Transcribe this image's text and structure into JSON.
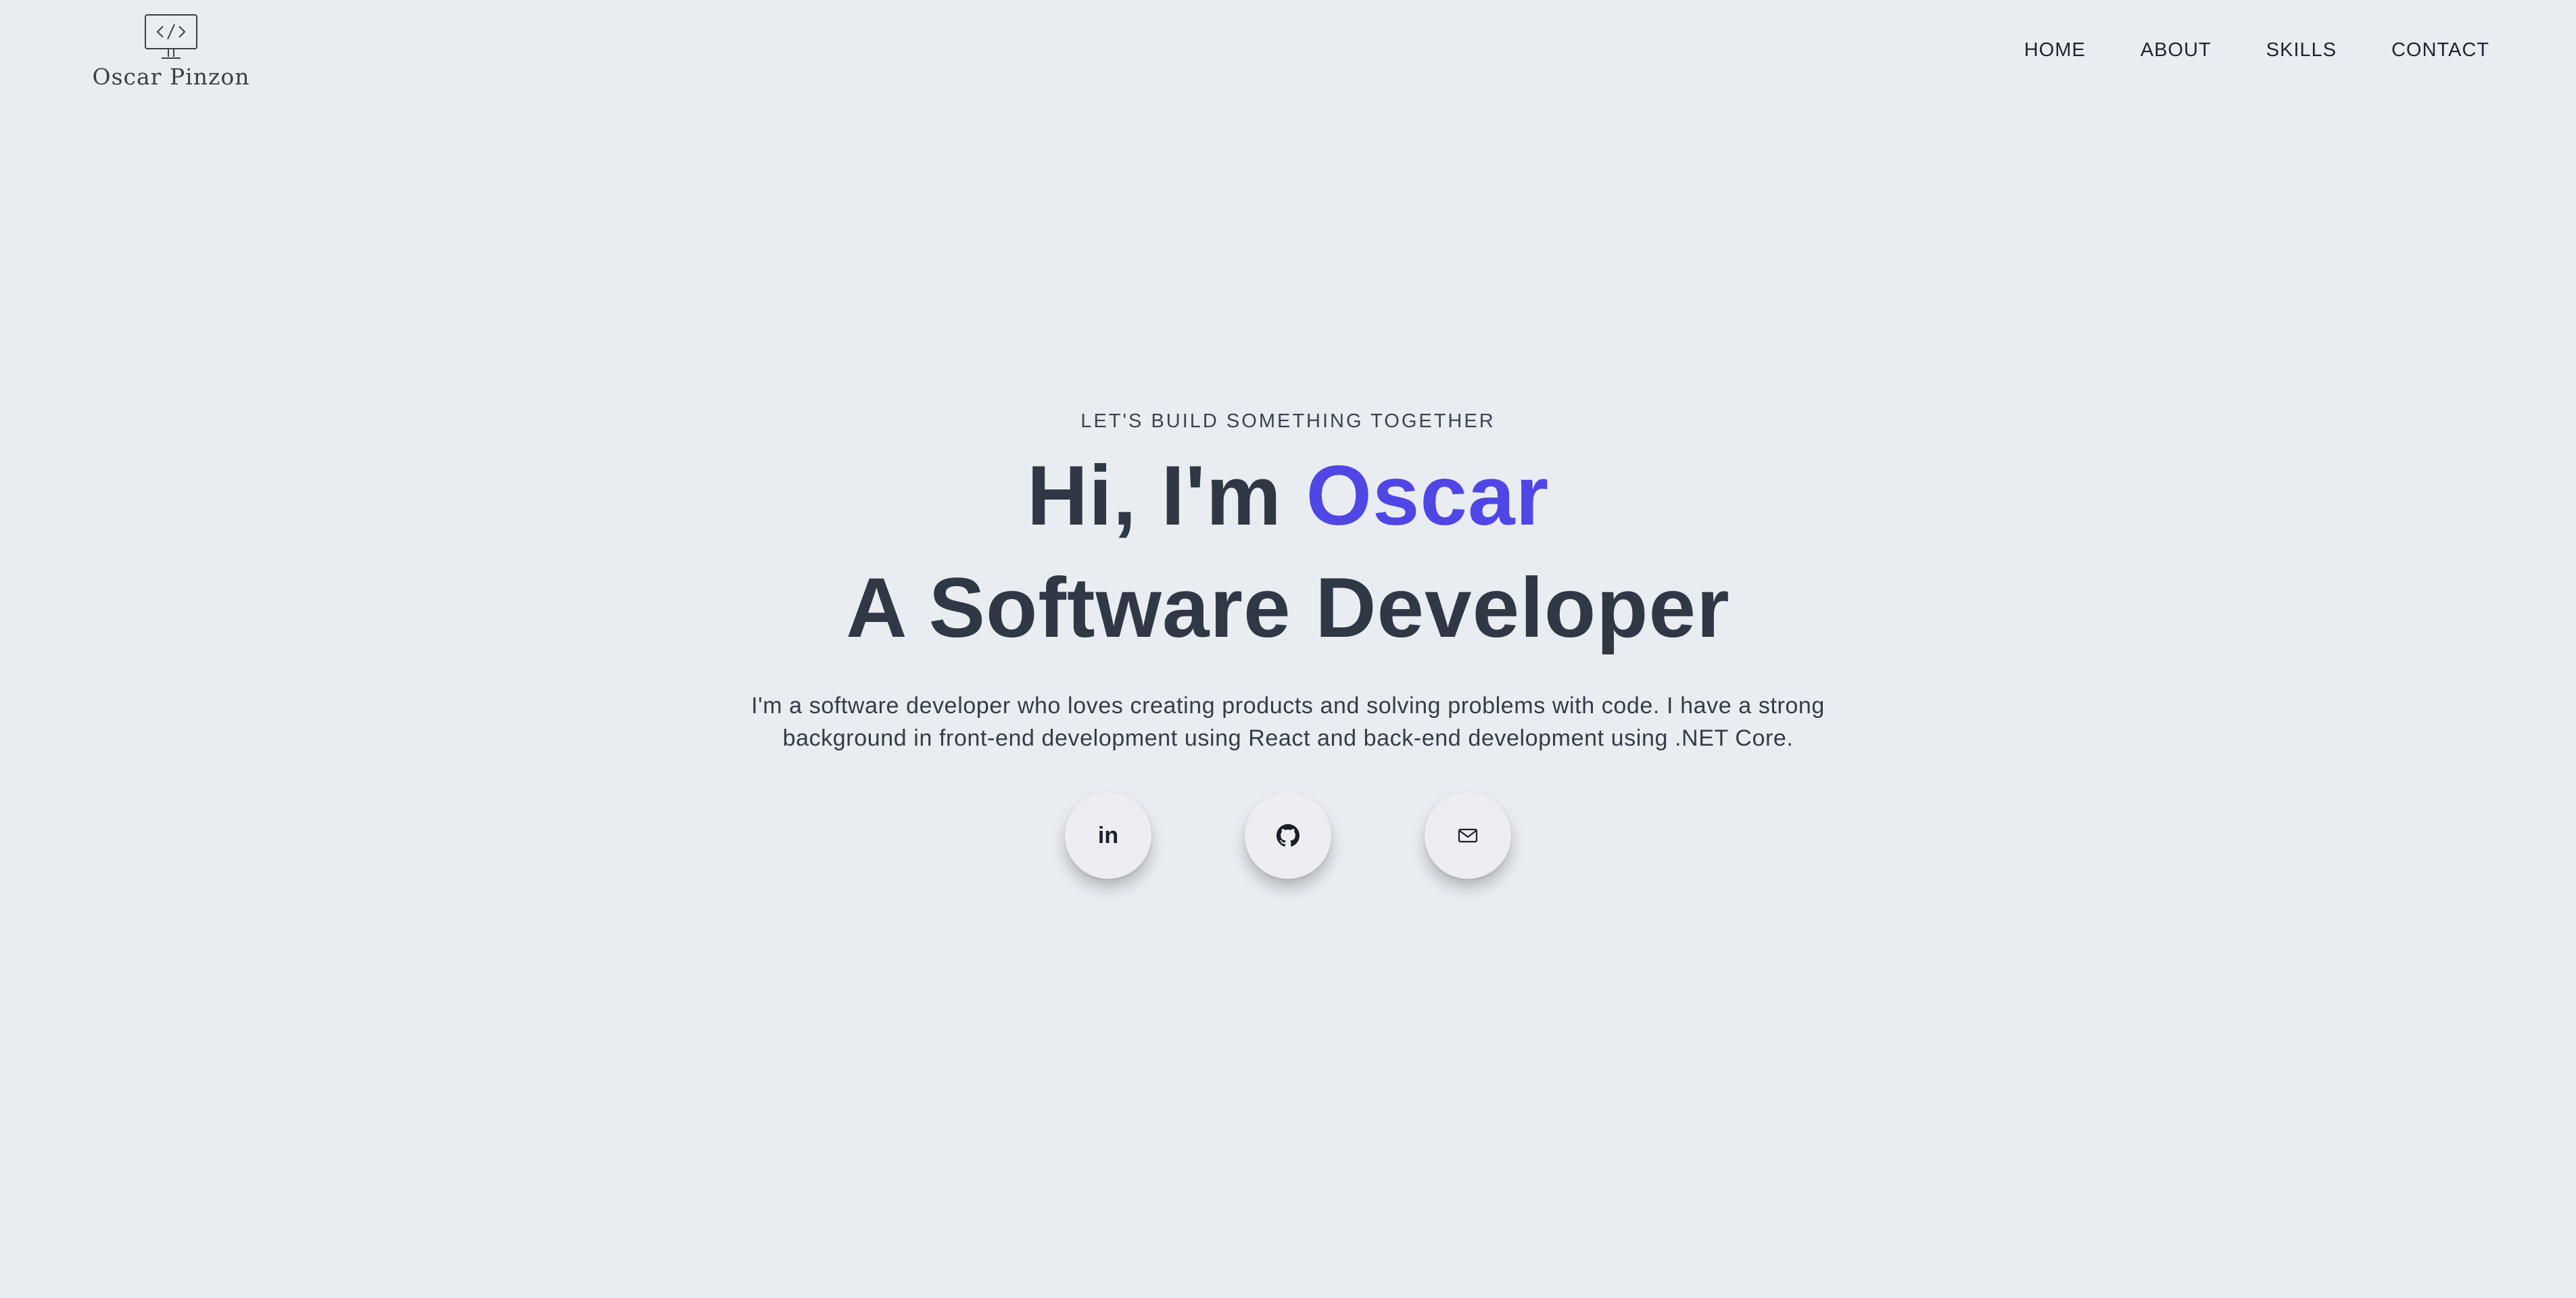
{
  "header": {
    "logo_icon": "code-monitor-icon",
    "logo_name": "Oscar Pinzon",
    "nav": [
      {
        "label": "HOME"
      },
      {
        "label": "ABOUT"
      },
      {
        "label": "SKILLS"
      },
      {
        "label": "CONTACT"
      }
    ]
  },
  "hero": {
    "tagline": "LET'S BUILD SOMETHING TOGETHER",
    "title_prefix": "Hi, I'm ",
    "title_name": "Oscar",
    "title_line2": "A Software Developer",
    "description": "I'm a software developer who loves creating products and solving problems with code. I have a strong background in front-end development using React and back-end development using .NET Core.",
    "accent_color": "#4f46e5"
  },
  "socials": [
    {
      "name": "linkedin",
      "icon": "linkedin-icon",
      "text": "in"
    },
    {
      "name": "github",
      "icon": "github-icon"
    },
    {
      "name": "email",
      "icon": "mail-icon"
    }
  ],
  "colors": {
    "background": "#e9edf1",
    "text": "#2f3644",
    "accent": "#4f46e5"
  }
}
